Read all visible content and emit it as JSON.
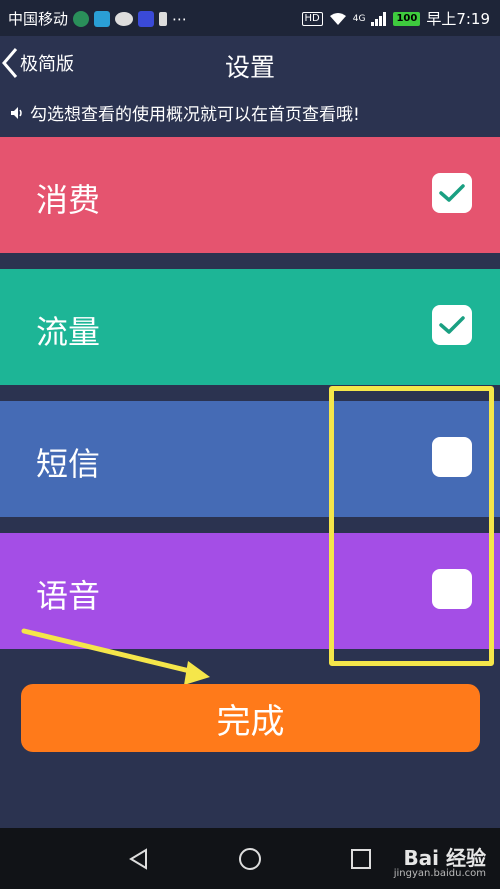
{
  "status_bar": {
    "carrier": "中国移动",
    "time": "早上7:19",
    "hd": "HD",
    "network": "4G",
    "battery": "100"
  },
  "header": {
    "back_label": "极简版",
    "title": "设置"
  },
  "notice": "勾选想查看的使用概况就可以在首页查看哦!",
  "items": [
    {
      "label": "消费",
      "checked": true,
      "color": "#e5546f"
    },
    {
      "label": "流量",
      "checked": true,
      "color": "#1db596"
    },
    {
      "label": "短信",
      "checked": false,
      "color": "#456bb5"
    },
    {
      "label": "语音",
      "checked": false,
      "color": "#a44ee6"
    }
  ],
  "done_button": "完成",
  "colors": {
    "background": "#2b3350",
    "done": "#ff7a1a",
    "highlight": "#f5e64a",
    "check": "#1aa082"
  },
  "watermark": {
    "brand": "Bai 经验",
    "url": "jingyan.baidu.com"
  }
}
